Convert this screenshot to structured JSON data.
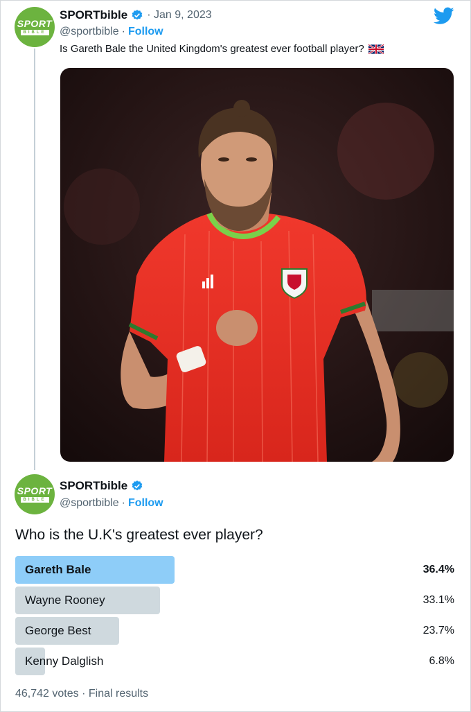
{
  "tweet": {
    "author": "SPORTbible",
    "avatar_text_top": "SPORT",
    "avatar_text_bottom": "BIBLE",
    "date": "Jan 9, 2023",
    "handle": "@sportbible",
    "follow_label": "Follow",
    "text": "Is Gareth Bale the United Kingdom's greatest ever football player?",
    "image_alt": "Gareth Bale running in a red Wales national team kit"
  },
  "reply": {
    "author": "SPORTbible",
    "avatar_text_top": "SPORT",
    "avatar_text_bottom": "BIBLE",
    "handle": "@sportbible",
    "follow_label": "Follow",
    "poll": {
      "question": "Who is the U.K's greatest ever player?",
      "options": [
        {
          "label": "Gareth Bale",
          "percent": "36.4%",
          "share": 0.364,
          "winner": true
        },
        {
          "label": "Wayne Rooney",
          "percent": "33.1%",
          "share": 0.331,
          "winner": false
        },
        {
          "label": "George Best",
          "percent": "23.7%",
          "share": 0.237,
          "winner": false
        },
        {
          "label": "Kenny Dalglish",
          "percent": "6.8%",
          "share": 0.068,
          "winner": false
        }
      ],
      "votes": "46,742 votes",
      "status": "Final results"
    }
  },
  "colors": {
    "accent": "#1d9bf0",
    "winner_bar": "#8ecdf8",
    "bar": "#cfd9de",
    "avatar": "#6cb33f"
  }
}
